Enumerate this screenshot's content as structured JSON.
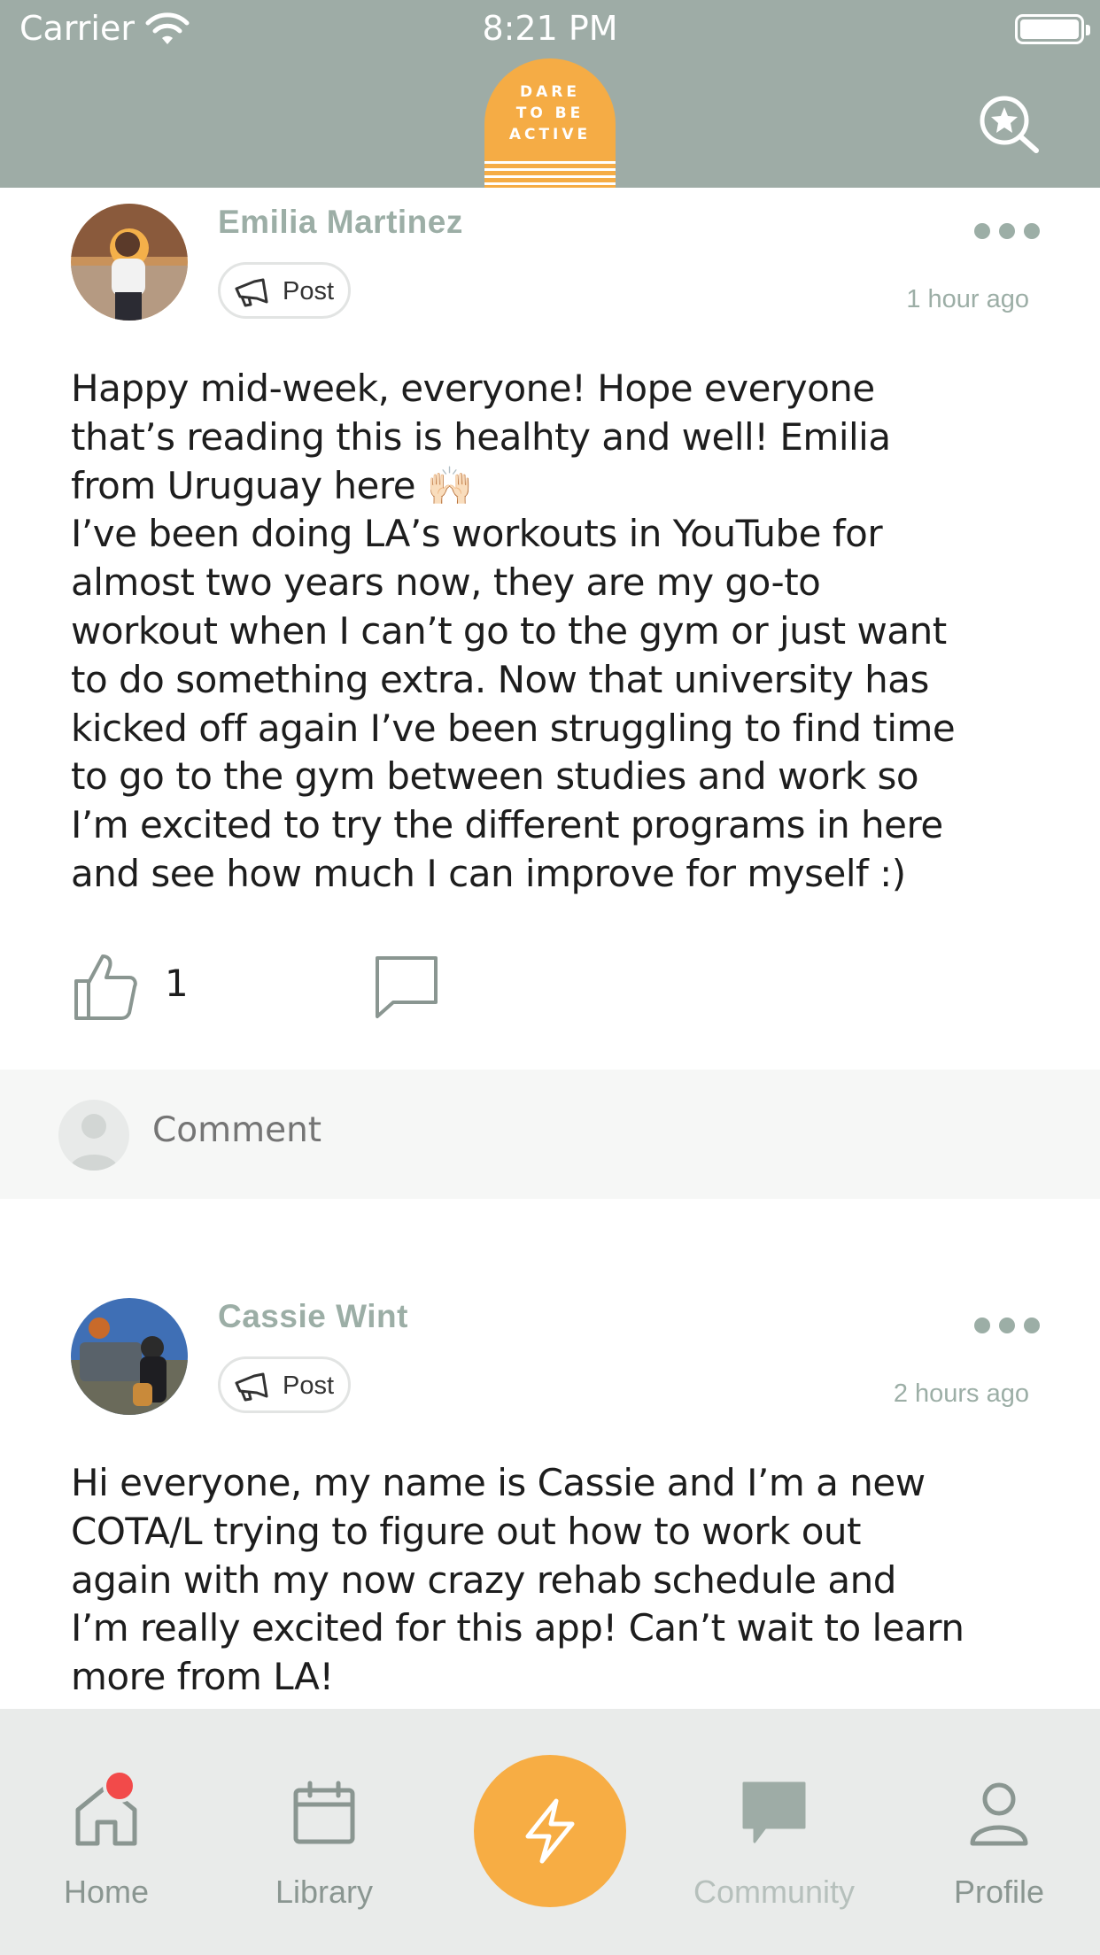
{
  "status_bar": {
    "carrier": "Carrier",
    "time": "8:21 PM"
  },
  "header": {
    "logo_lines": [
      "DARE",
      "TO BE",
      "ACTIVE"
    ],
    "search_icon": "search-star-icon",
    "background_color": "#9eaca6",
    "logo_color": "#f5ac45"
  },
  "posts": [
    {
      "author": "Emilia Martinez",
      "type_label": "Post",
      "time_ago": "1 hour ago",
      "text": "Happy mid-week, everyone! Hope everyone\nthat’s reading this is healhty and well! Emilia\nfrom Uruguay here 🙌🏻\nI’ve been doing LA’s workouts in YouTube for\nalmost two years now, they are my go-to\nworkout when I can’t go to the gym or just want\nto do something extra. Now that university has\nkicked off again I’ve been struggling to find time\nto go to the gym between studies and work so\nI’m excited to try the different programs in here\nand see how much I can improve for myself :)",
      "like_count": "1",
      "comment_placeholder": "Comment"
    },
    {
      "author": "Cassie Wint",
      "type_label": "Post",
      "time_ago": "2 hours ago",
      "text": "Hi everyone, my name is Cassie and I’m a new\nCOTA/L trying to figure out how to work out\nagain with my now crazy rehab schedule and\nI’m really excited for this app! Can’t wait to learn\nmore from LA!"
    }
  ],
  "tab_bar": {
    "tabs": [
      {
        "label": "Home",
        "icon": "home-icon",
        "has_badge": true
      },
      {
        "label": "Library",
        "icon": "calendar-icon"
      },
      {
        "label": "",
        "icon": "lightning-icon",
        "center": true
      },
      {
        "label": "Community",
        "icon": "chat-bubble-icon",
        "active": true
      },
      {
        "label": "Profile",
        "icon": "person-icon"
      }
    ],
    "badge_color": "#f24a4a",
    "center_button_color": "#f7ad44"
  }
}
